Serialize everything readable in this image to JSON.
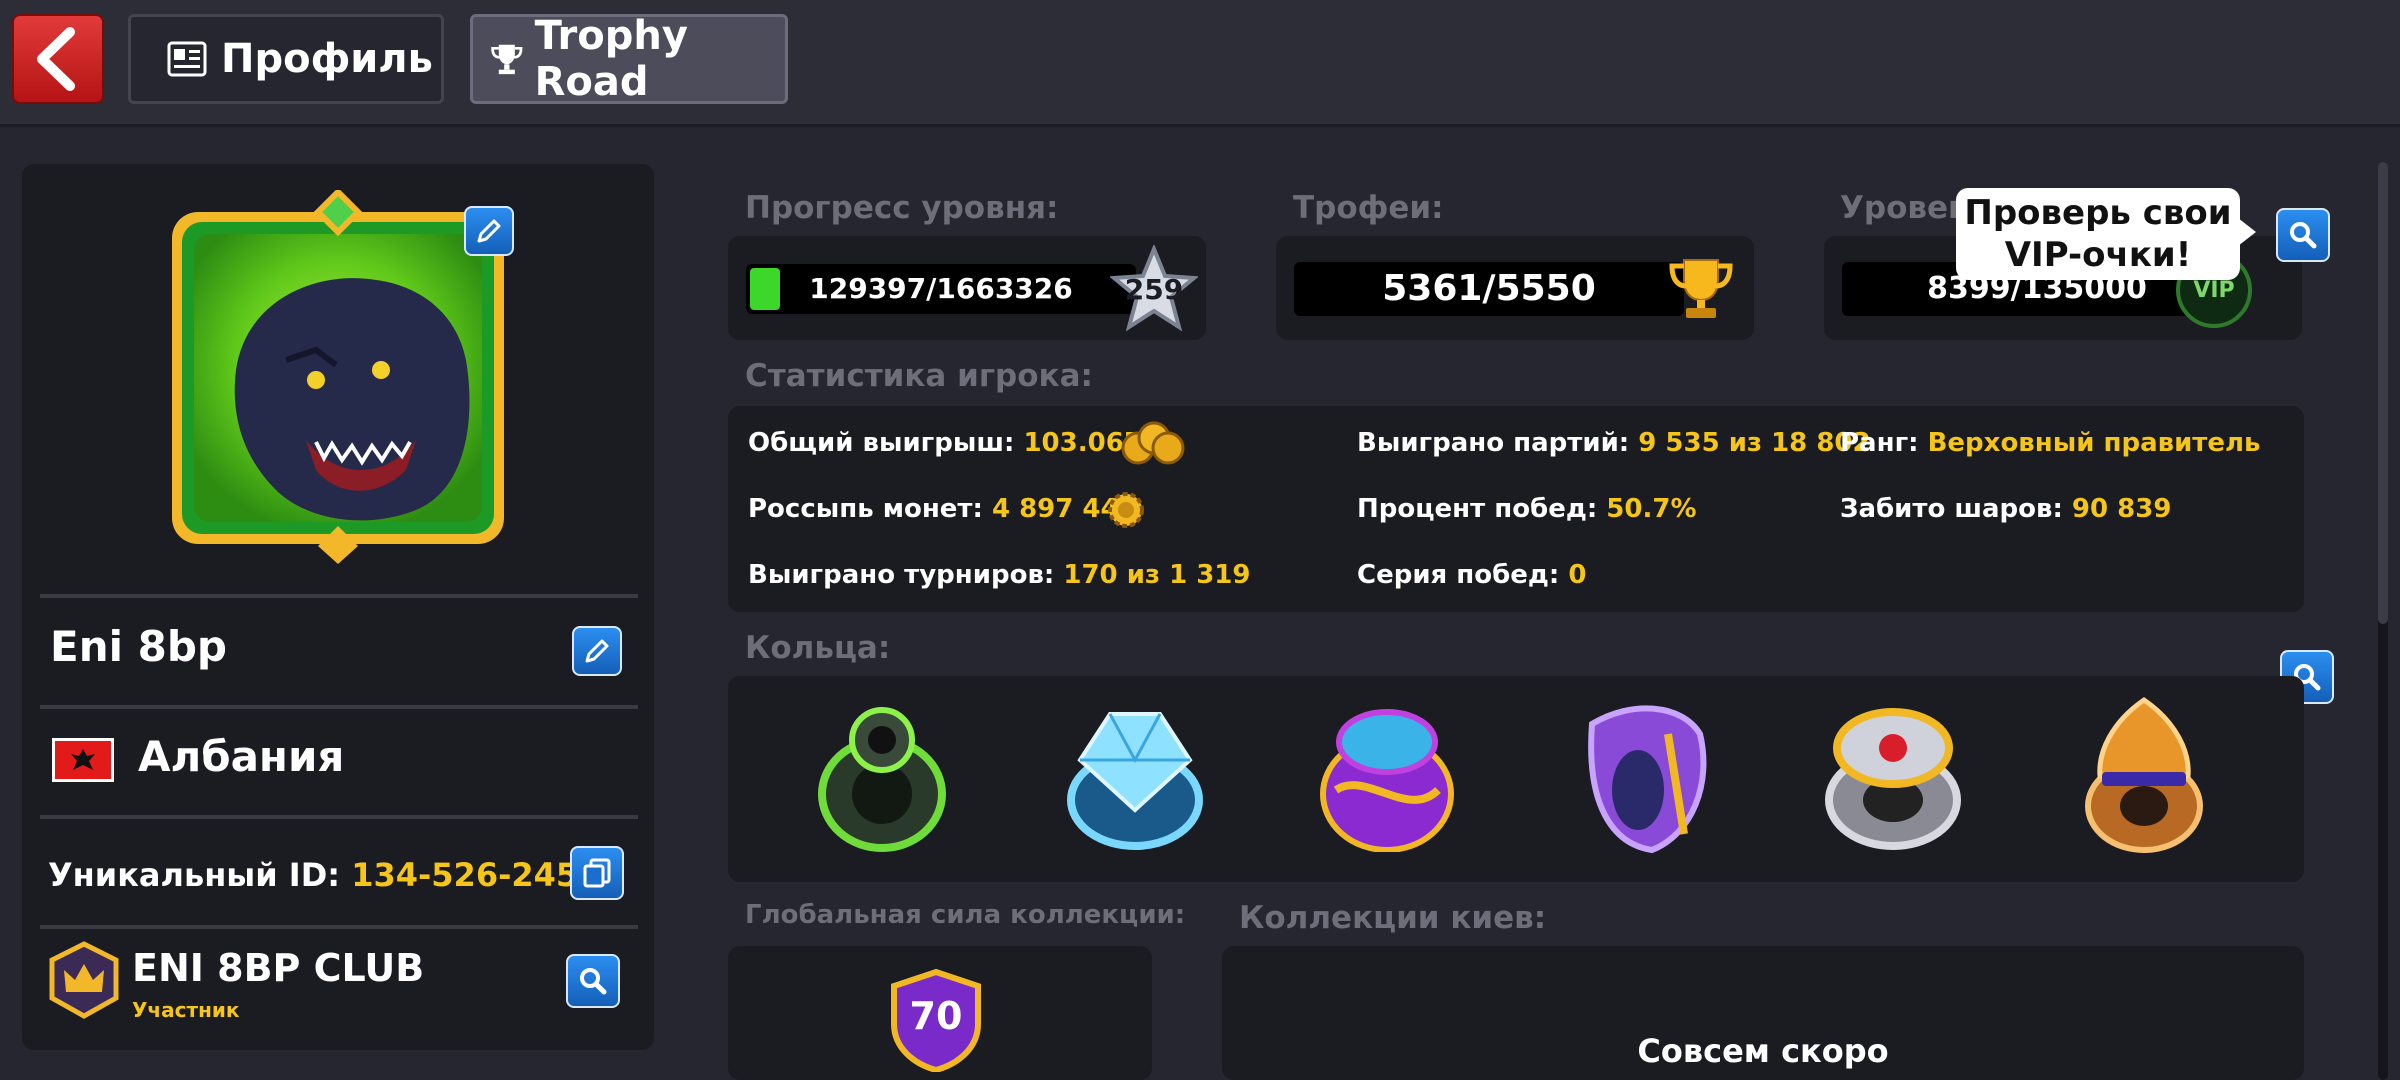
{
  "header": {
    "tabs": [
      {
        "label": "Профиль",
        "icon": "profile-card-icon"
      },
      {
        "label": "Trophy Road",
        "icon": "trophy-icon"
      }
    ]
  },
  "profile": {
    "name": "Eni 8bp",
    "country": "Албания",
    "unique_id_label": "Уникальный ID:",
    "unique_id": "134-526-245-9",
    "club_name": "ENI 8BP CLUB",
    "club_role": "Участник"
  },
  "level": {
    "label": "Прогресс уровня:",
    "progress": "129397/1663326",
    "level_number": "259",
    "fill_fraction": 0.078
  },
  "trophies": {
    "label": "Трофеи:",
    "value": "5361/5550"
  },
  "vip": {
    "label": "Уровень",
    "value": "8399/135000",
    "badge": "VIP",
    "tooltip_line1": "Проверь свои",
    "tooltip_line2": "VIP-очки!"
  },
  "stats": {
    "label": "Статистика игрока:",
    "items": [
      {
        "label": "Общий выигрыш:",
        "value": "103.06B"
      },
      {
        "label": "Выиграно партий:",
        "value": "9 535 из 18 802"
      },
      {
        "label": "Ранг:",
        "value": "Верховный правитель"
      },
      {
        "label": "Россыпь монет:",
        "value": "4 897 446"
      },
      {
        "label": "Процент побед:",
        "value": "50.7%"
      },
      {
        "label": "Забито шаров:",
        "value": "90 839"
      },
      {
        "label": "Выиграно турниров:",
        "value": "170 из 1 319"
      },
      {
        "label": "Серия побед:",
        "value": "0"
      }
    ]
  },
  "rings": {
    "label": "Кольца:",
    "items": [
      "ring-8ball",
      "ring-diamond",
      "ring-tough",
      "ring-unstable",
      "ring-silver-gold",
      "ring-gold-orange"
    ]
  },
  "collection_power": {
    "label": "Глобальная сила коллекции:",
    "value": "70"
  },
  "cue_collections": {
    "label": "Коллекции киев:",
    "status": "Совсем скоро"
  },
  "colors": {
    "accent_yellow": "#f5c518",
    "button_blue": "#1f7ad9",
    "back_red": "#d12828"
  }
}
